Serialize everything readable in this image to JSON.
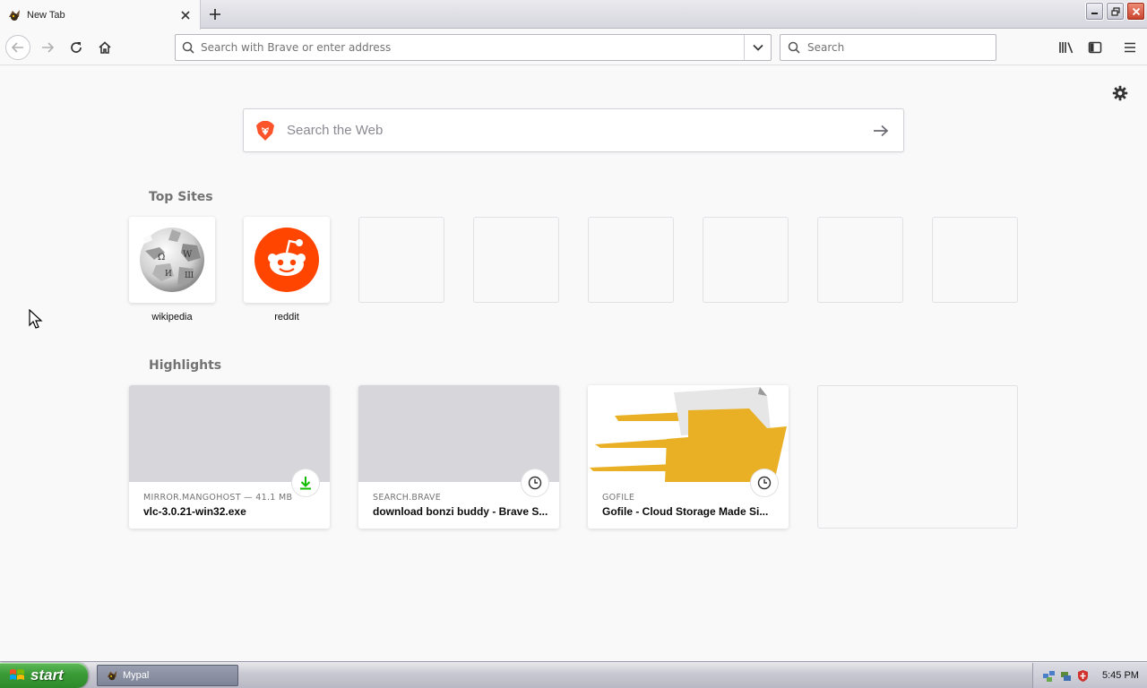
{
  "tab": {
    "title": "New Tab"
  },
  "navbar": {
    "url_placeholder": "Search with Brave or enter address",
    "search_placeholder": "Search"
  },
  "newtab": {
    "websearch_placeholder": "Search the Web",
    "topsites_title": "Top Sites",
    "topsites": [
      {
        "label": "wikipedia",
        "icon": "wikipedia-globe-icon"
      },
      {
        "label": "reddit",
        "icon": "reddit-alien-icon"
      },
      {
        "label": ""
      },
      {
        "label": ""
      },
      {
        "label": ""
      },
      {
        "label": ""
      },
      {
        "label": ""
      },
      {
        "label": ""
      }
    ],
    "highlights_title": "Highlights",
    "highlights": [
      {
        "source": "MIRROR.MANGOHOST — 41.1 MB",
        "title": "vlc-3.0.21-win32.exe",
        "badge": "download-icon"
      },
      {
        "source": "SEARCH.BRAVE",
        "title": "download bonzi buddy - Brave S...",
        "badge": "clock-icon"
      },
      {
        "source": "GOFILE",
        "title": "Gofile - Cloud Storage Made Si...",
        "badge": "clock-icon"
      }
    ]
  },
  "taskbar": {
    "start_label": "start",
    "window_label": "Mypal",
    "clock": "5:45 PM"
  },
  "colors": {
    "reddit": "#ff4500",
    "brave": "#fb542b",
    "download_green": "#12bc00",
    "gofile_yellow": "#e9b025"
  }
}
